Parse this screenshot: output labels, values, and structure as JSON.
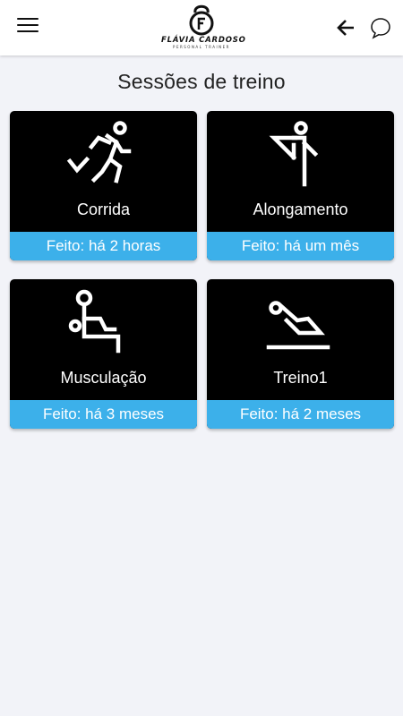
{
  "header": {
    "logo_name": "FLÁVIA CARDOSO",
    "logo_subtitle": "PERSONAL TRAINER",
    "menu_icon": "hamburger-menu-icon",
    "back_icon": "arrow-left-icon",
    "chat_icon": "chat-bubble-icon"
  },
  "page": {
    "title": "Sessões de treino"
  },
  "sessions": [
    {
      "name": "Corrida",
      "status": "Feito: há 2 horas",
      "icon": "running-person-icon"
    },
    {
      "name": "Alongamento",
      "status": "Feito: há um mês",
      "icon": "stretching-person-icon"
    },
    {
      "name": "Musculação",
      "status": "Feito: há 3 meses",
      "icon": "weightlifting-person-icon"
    },
    {
      "name": "Treino1",
      "status": "Feito: há 2 meses",
      "icon": "floor-exercise-person-icon"
    }
  ],
  "colors": {
    "background": "#f2f3f8",
    "card": "#000000",
    "status_bar": "#3cb0ea",
    "text_light": "#ffffff"
  }
}
